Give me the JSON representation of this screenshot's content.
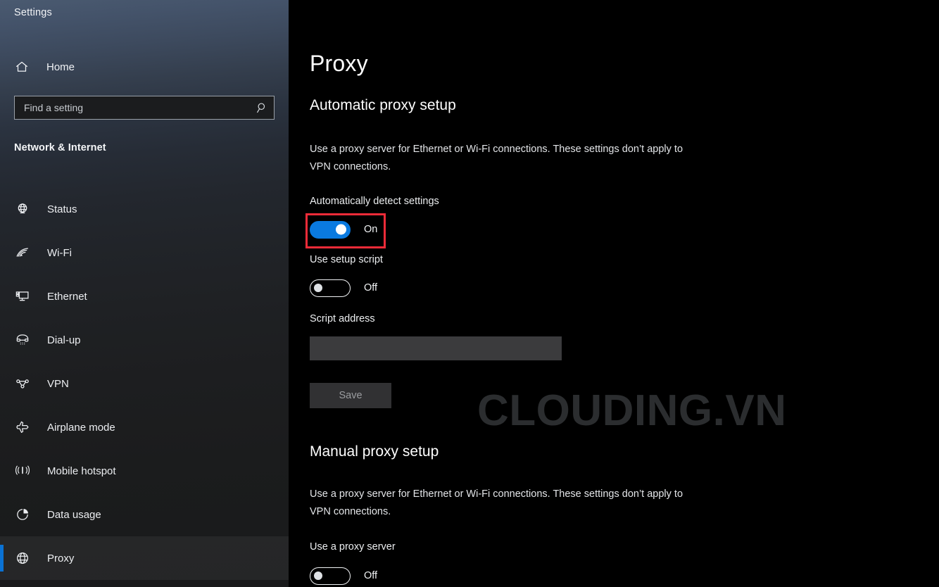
{
  "window": {
    "title": "Settings"
  },
  "sidebar": {
    "home_label": "Home",
    "search": {
      "placeholder": "Find a setting",
      "value": "",
      "icon": "search-icon"
    },
    "section_heading": "Network & Internet",
    "items": [
      {
        "label": "Status",
        "icon": "status-globe-icon",
        "selected": false
      },
      {
        "label": "Wi-Fi",
        "icon": "wifi-icon",
        "selected": false
      },
      {
        "label": "Ethernet",
        "icon": "ethernet-icon",
        "selected": false
      },
      {
        "label": "Dial-up",
        "icon": "dialup-phone-icon",
        "selected": false
      },
      {
        "label": "VPN",
        "icon": "vpn-icon",
        "selected": false
      },
      {
        "label": "Airplane mode",
        "icon": "airplane-icon",
        "selected": false
      },
      {
        "label": "Mobile hotspot",
        "icon": "hotspot-icon",
        "selected": false
      },
      {
        "label": "Data usage",
        "icon": "data-usage-pie-icon",
        "selected": false
      },
      {
        "label": "Proxy",
        "icon": "proxy-globe-icon",
        "selected": true
      }
    ]
  },
  "main": {
    "page_title": "Proxy",
    "automatic": {
      "heading": "Automatic proxy setup",
      "description": "Use a proxy server for Ethernet or Wi-Fi connections. These settings don’t apply to VPN connections.",
      "auto_detect": {
        "label": "Automatically detect settings",
        "state": "On"
      },
      "setup_script": {
        "label": "Use setup script",
        "state": "Off"
      },
      "script_address": {
        "label": "Script address",
        "value": "",
        "placeholder": ""
      },
      "save_label": "Save"
    },
    "manual": {
      "heading": "Manual proxy setup",
      "description": "Use a proxy server for Ethernet or Wi-Fi connections. These settings don’t apply to VPN connections.",
      "use_proxy": {
        "label": "Use a proxy server",
        "state": "Off"
      }
    },
    "watermark": "CLOUDING.VN"
  },
  "colors": {
    "accent": "#0a7ae0",
    "selection_bar": "#0a72d4",
    "highlight_box": "#ef2b38",
    "watermark": "#2b2d2f",
    "page_background": "#000000"
  }
}
